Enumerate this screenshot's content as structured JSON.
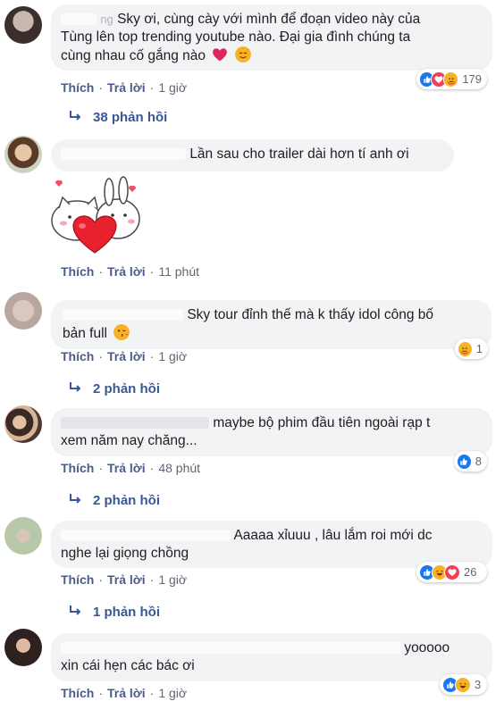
{
  "comments": [
    {
      "name_partial": "ng",
      "text_line1": "Sky ơi, cùng cày với mình để đoạn video này của",
      "text_line2": "Tùng lên top trending youtube nào. Đại gia đình chúng ta",
      "text_line3": "cùng nhau cố gắng nào",
      "like": "Thích",
      "reply": "Trả lời",
      "time": "1 giờ",
      "reaction_count": "179",
      "replies": "38 phản hồi"
    },
    {
      "text_line1": "Lần sau cho trailer dài hơn tí anh ơi",
      "sticker": "bunny-heart-sticker",
      "like": "Thích",
      "reply": "Trả lời",
      "time": "11 phút"
    },
    {
      "text_line1": "Sky tour đỉnh thế mà k thấy idol công bố",
      "text_line2": "bản full",
      "like": "Thích",
      "reply": "Trả lời",
      "time": "1 giờ",
      "reaction_count": "1",
      "replies": "2 phản hồi"
    },
    {
      "text_line1": "maybe bộ phim đầu tiên ngoài rạp t",
      "text_line2": "xem năm nay chăng...",
      "like": "Thích",
      "reply": "Trả lời",
      "time": "48 phút",
      "reaction_count": "8",
      "replies": "2 phản hồi"
    },
    {
      "text_line1": "Aaaaa xỉuuu , lâu lắm roi mới dc",
      "text_line2": "nghe lại giọng chồng",
      "like": "Thích",
      "reply": "Trả lời",
      "time": "1 giờ",
      "reaction_count": "26",
      "replies": "1 phản hồi"
    },
    {
      "text_line1": "yooooo",
      "text_line2": "xin cái hẹn các bác ơi",
      "like": "Thích",
      "reply": "Trả lời",
      "time": "1 giờ",
      "reaction_count": "3"
    }
  ],
  "icons": {
    "like": "like-reaction-icon",
    "love": "love-reaction-icon",
    "haha": "haha-reaction-icon",
    "care": "care-reaction-icon",
    "reply_arrow": "reply-arrow-icon"
  },
  "colors": {
    "link": "#385898",
    "meta_link": "#4b5b8a",
    "bubble": "#f2f3f5",
    "like": "#1877f2",
    "love": "#f33e58",
    "haha": "#f7b125"
  }
}
